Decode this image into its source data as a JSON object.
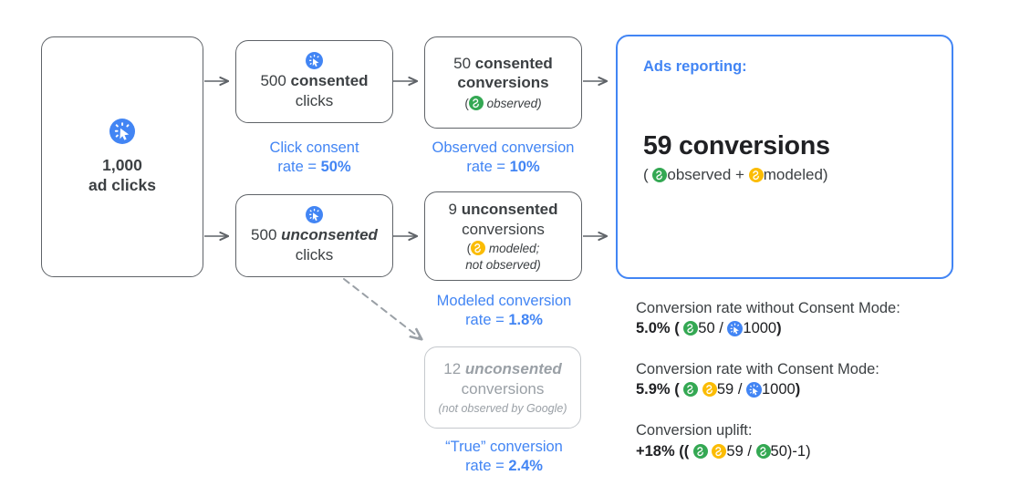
{
  "colors": {
    "blue": "#4285f4",
    "green": "#34a853",
    "yellow": "#fbbc04",
    "grey_text": "#9aa0a6",
    "dark_text": "#3c4043",
    "box_border": "#5f6368"
  },
  "boxes": {
    "ad_clicks": {
      "icon": "click-icon",
      "line1": "1,000",
      "line2": "ad clicks"
    },
    "consented_clicks": {
      "icon": "click-icon",
      "count": "500 ",
      "emphasis": "consented",
      "line2": "clicks"
    },
    "unconsented_clicks": {
      "icon": "click-icon",
      "count": "500 ",
      "emphasis": "unconsented",
      "line2": "clicks"
    },
    "consented_conversions": {
      "count": "50 ",
      "emphasis": "consented",
      "line2": "conversions",
      "note_open": "(",
      "note_icon": "conversion-observed-icon",
      "note_text": "observed",
      "note_close": ")"
    },
    "unconsented_conversions": {
      "count": "9 ",
      "emphasis": "unconsented",
      "line2": "conversions",
      "note_open": "(",
      "note_icon": "conversion-modeled-icon",
      "note_text": "modeled;",
      "note_line2": "not observed)"
    },
    "true_conversions": {
      "count": "12 ",
      "emphasis": "unconsented",
      "line2": "conversions",
      "note": "(not observed by Google)"
    }
  },
  "labels": {
    "click_consent": {
      "line1": "Click consent",
      "line2_prefix": "rate = ",
      "line2_value": "50%"
    },
    "observed_conversion": {
      "line1": "Observed conversion",
      "line2_prefix": "rate = ",
      "line2_value": "10%"
    },
    "modeled_conversion": {
      "line1": "Modeled conversion",
      "line2_prefix": "rate = ",
      "line2_value": "1.8%"
    },
    "true_conversion": {
      "line1": "“True” conversion",
      "line2_prefix": "rate = ",
      "line2_value": "2.4%"
    }
  },
  "reporting": {
    "title": "Ads reporting:",
    "headline": "59 conversions",
    "sub_open": "( ",
    "sub_observed_icon": "conversion-observed-icon",
    "sub_observed": "observed + ",
    "sub_modeled_icon": "conversion-modeled-icon",
    "sub_modeled": "modeled)"
  },
  "stats": [
    {
      "label": "Conversion rate without Consent Mode:",
      "value_prefix": "5.0% ( ",
      "icons": [
        "conversion-observed-icon"
      ],
      "numerator": "50",
      "divider": " / ",
      "denominator_icon": "click-icon",
      "denominator": "1000",
      "value_suffix": ")"
    },
    {
      "label": "Conversion rate with Consent Mode:",
      "value_prefix": "5.9% ( ",
      "icons": [
        "conversion-observed-icon",
        "conversion-modeled-icon"
      ],
      "numerator": "59",
      "divider": " / ",
      "denominator_icon": "click-icon",
      "denominator": "1000",
      "value_suffix": ")"
    },
    {
      "label": "Conversion uplift:",
      "value_prefix": "+18% (( ",
      "icons": [
        "conversion-observed-icon",
        "conversion-modeled-icon"
      ],
      "numerator": "59",
      "divider": " / ",
      "denominator_icon": "conversion-observed-icon",
      "denominator": "50",
      "value_suffix": ")-1)"
    }
  ]
}
